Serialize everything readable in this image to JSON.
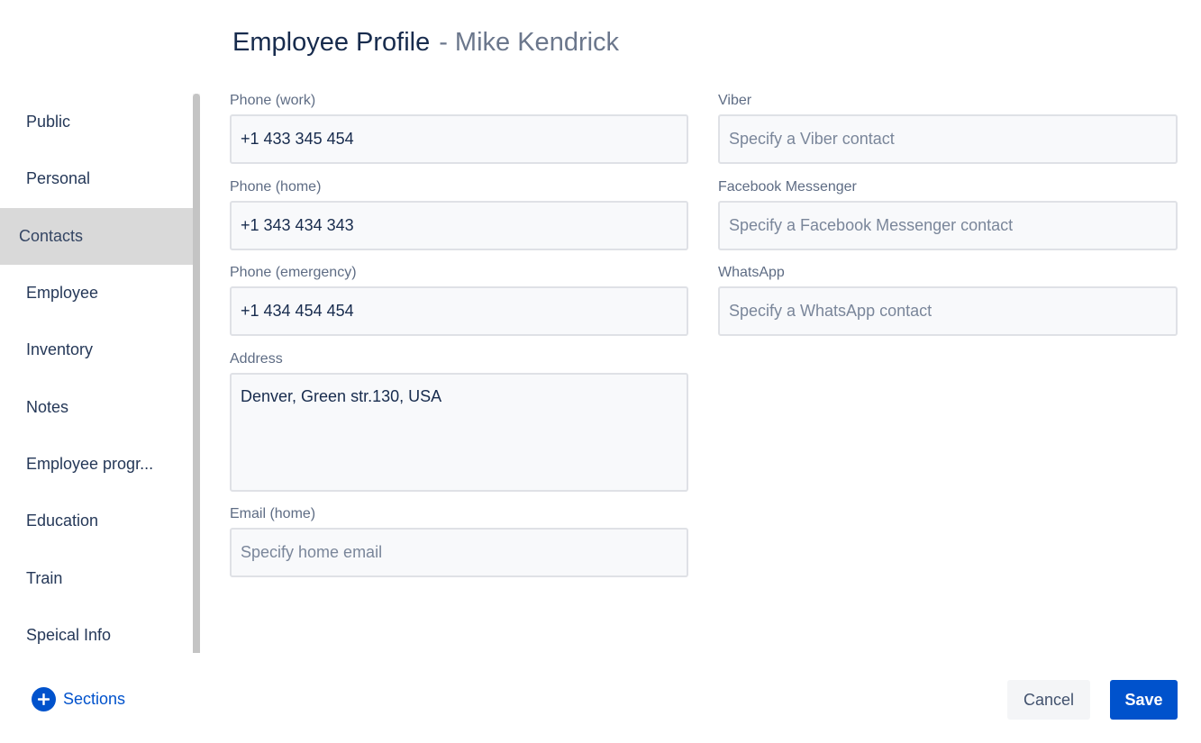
{
  "header": {
    "title": "Employee Profile",
    "subtitle": "- Mike Kendrick"
  },
  "sidebar": {
    "items": [
      {
        "label": "Public"
      },
      {
        "label": "Personal"
      },
      {
        "label": "Contacts",
        "active": true
      },
      {
        "label": "Employee"
      },
      {
        "label": "Inventory"
      },
      {
        "label": "Notes"
      },
      {
        "label": "Employee progr..."
      },
      {
        "label": "Education"
      },
      {
        "label": "Train"
      },
      {
        "label": "Speical Info"
      }
    ]
  },
  "form": {
    "phone_work": {
      "label": "Phone (work)",
      "value": "+1 433 345 454",
      "placeholder": ""
    },
    "phone_home": {
      "label": "Phone (home)",
      "value": "+1 343 434 343",
      "placeholder": ""
    },
    "phone_emergency": {
      "label": "Phone (emergency)",
      "value": "+1 434 454 454",
      "placeholder": ""
    },
    "address": {
      "label": "Address",
      "value": "Denver, Green str.130, USA",
      "placeholder": ""
    },
    "email_home": {
      "label": "Email (home)",
      "value": "",
      "placeholder": "Specify home email"
    },
    "viber": {
      "label": "Viber",
      "value": "",
      "placeholder": "Specify a Viber contact"
    },
    "facebook_messenger": {
      "label": "Facebook Messenger",
      "value": "",
      "placeholder": "Specify a Facebook Messenger contact"
    },
    "whatsapp": {
      "label": "WhatsApp",
      "value": "",
      "placeholder": "Specify a WhatsApp contact"
    }
  },
  "footer": {
    "sections_label": "Sections",
    "cancel_label": "Cancel",
    "save_label": "Save"
  },
  "colors": {
    "accent": "#0052cc",
    "active_sidebar_bg": "#d9d9d9",
    "input_bg": "#f8f9fb",
    "input_border": "#dfe1e6"
  },
  "icons": {
    "add_sections": "plus-circle-icon"
  }
}
